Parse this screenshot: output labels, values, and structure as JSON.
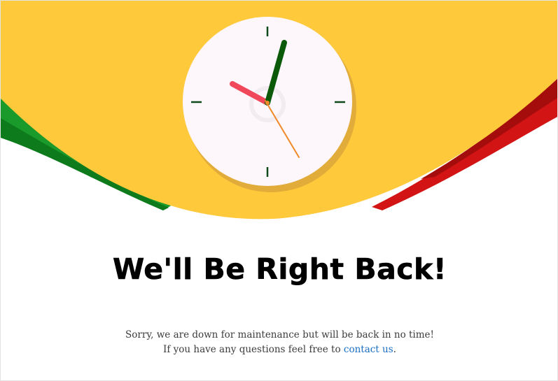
{
  "colors": {
    "background": "#ffffff",
    "banner_yellow": "#ffc93c",
    "ribbon_green": "#1a9a2a",
    "ribbon_green_dark": "#0d7a1c",
    "ribbon_red": "#d21414",
    "ribbon_red_dark": "#a50d0d",
    "clock_face": "#fdf6fb",
    "hour_hand": "#f0475a",
    "minute_hand": "#0a5a0a",
    "second_hand": "#f08a2a",
    "link": "#1a6fc4"
  },
  "clock": {
    "hour_hand_label": "hour-hand",
    "minute_hand_label": "minute-hand",
    "second_hand_label": "second-hand"
  },
  "heading": "We'll Be Right Back!",
  "message": {
    "line1": "Sorry, we are down for maintenance but will be back in no time!",
    "line2_prefix": "If you have any questions feel free to ",
    "link_text": "contact us",
    "line2_suffix": "."
  }
}
